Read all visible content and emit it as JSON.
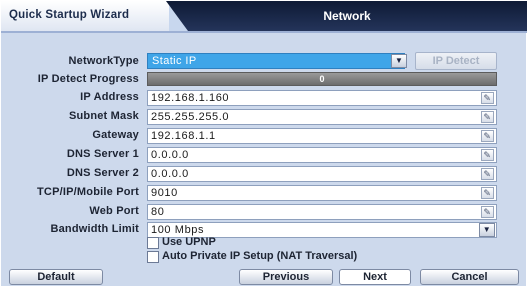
{
  "header": {
    "wizard_label": "Quick Startup Wizard",
    "title": "Network"
  },
  "form": {
    "network_type": {
      "label": "NetworkType",
      "value": "Static IP"
    },
    "ip_detect_button": "IP Detect",
    "ip_detect_progress": {
      "label": "IP Detect Progress",
      "value": "0"
    },
    "ip_address": {
      "label": "IP Address",
      "value": "192.168.1.160"
    },
    "subnet_mask": {
      "label": "Subnet Mask",
      "value": "255.255.255.0"
    },
    "gateway": {
      "label": "Gateway",
      "value": "192.168.1.1"
    },
    "dns1": {
      "label": "DNS Server 1",
      "value": "0.0.0.0"
    },
    "dns2": {
      "label": "DNS Server 2",
      "value": "0.0.0.0"
    },
    "tcp_port": {
      "label": "TCP/IP/Mobile Port",
      "value": "9010"
    },
    "web_port": {
      "label": "Web Port",
      "value": "80"
    },
    "bandwidth": {
      "label": "Bandwidth Limit",
      "value": "100 Mbps"
    },
    "use_upnp": {
      "label": "Use UPNP",
      "checked": false
    },
    "auto_private_ip": {
      "label": "Auto Private IP Setup (NAT Traversal)",
      "checked": false
    }
  },
  "buttons": {
    "default": "Default",
    "previous": "Previous",
    "next": "Next",
    "cancel": "Cancel"
  },
  "icons": {
    "edit": "pencil-icon",
    "dropdown": "triangle-down-icon"
  },
  "colors": {
    "selected_field": "#3fa5e8",
    "header_dark": "#0e1a35",
    "panel_bg": "#cdd9ec",
    "progress_bar": "#7a7a7a"
  }
}
